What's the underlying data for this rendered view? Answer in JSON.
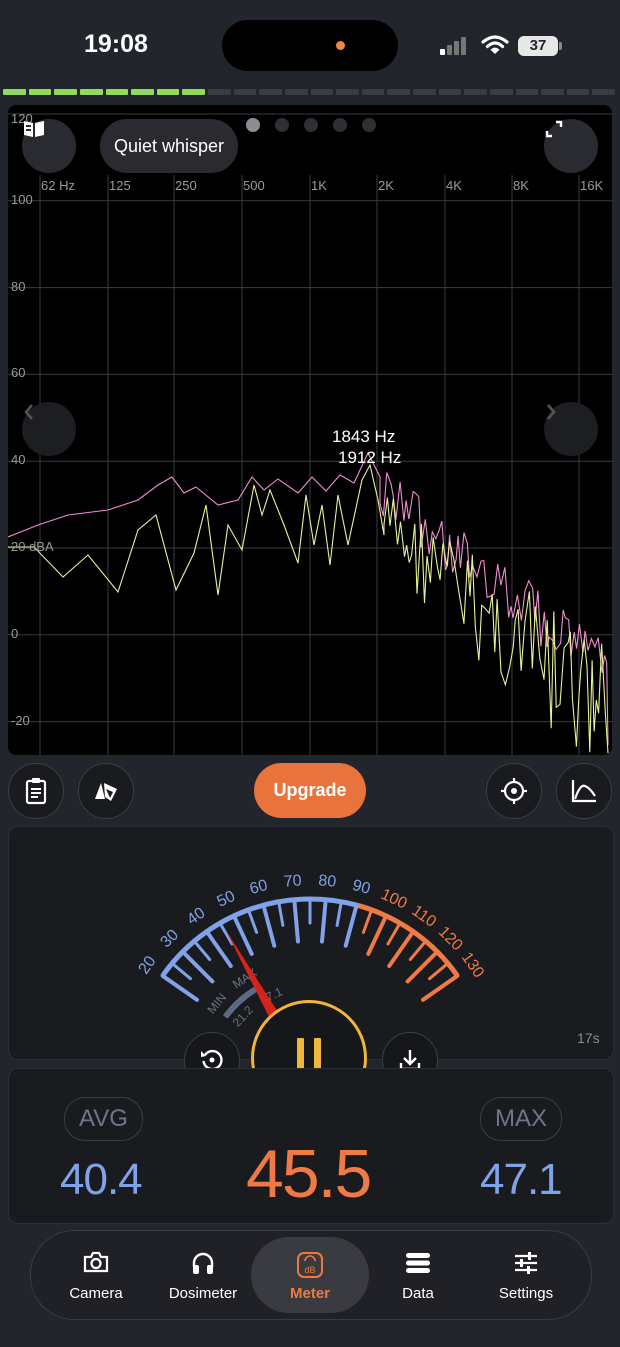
{
  "status_bar": {
    "time": "19:08",
    "battery": "37"
  },
  "spectrum": {
    "mode_label": "Quiet whisper",
    "y_labels": [
      "120",
      "100",
      "80",
      "60",
      "40",
      "20 dBA",
      "0",
      "-20"
    ],
    "x_labels": [
      "62 Hz",
      "125",
      "250",
      "500",
      "1K",
      "2K",
      "4K",
      "8K",
      "16K"
    ],
    "peak_labels": [
      "1843 Hz",
      "1912 Hz"
    ],
    "page_count": 5,
    "active_page": 1,
    "colors": {
      "live": "#e6f29a",
      "max": "#f08fd0",
      "grid": "#3a3b40"
    }
  },
  "toolbar": {
    "upgrade_label": "Upgrade"
  },
  "meter": {
    "scale_labels": [
      "20",
      "30",
      "40",
      "50",
      "60",
      "70",
      "80",
      "90",
      "100",
      "110",
      "120",
      "130"
    ],
    "min_label": "MIN",
    "max_label": "MAX",
    "min_value": "21.2",
    "max_value": "47.1",
    "needle_value": 45.5,
    "elapsed": "17s",
    "colors": {
      "low": "#7fa2e8",
      "high": "#ef7a45",
      "needle": "#d6241c",
      "pause": "#f1b53c"
    }
  },
  "stats": {
    "avg_label": "AVG",
    "avg_value": "40.4",
    "current_value": "45.5",
    "max_label": "MAX",
    "max_value": "47.1"
  },
  "tabs": [
    {
      "label": "Camera",
      "icon": "camera-icon"
    },
    {
      "label": "Dosimeter",
      "icon": "headphones-icon"
    },
    {
      "label": "Meter",
      "icon": "db-meter-icon",
      "active": true
    },
    {
      "label": "Data",
      "icon": "data-icon"
    },
    {
      "label": "Settings",
      "icon": "sliders-icon"
    }
  ]
}
